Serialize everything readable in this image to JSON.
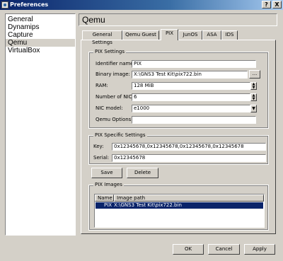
{
  "window": {
    "title": "Preferences",
    "help_label": "?",
    "close_label": "X"
  },
  "categories": [
    "General",
    "Dynamips",
    "Capture",
    "Qemu",
    "VirtualBox"
  ],
  "selected_category": "Qemu",
  "header": {
    "title": "Qemu"
  },
  "tabs": [
    "General Settings",
    "Qemu Guest",
    "PIX",
    "JunOS",
    "ASA",
    "IDS"
  ],
  "active_tab": "PIX",
  "pix_settings": {
    "group_title": "PIX Settings",
    "identifier_label": "Identifier name:",
    "identifier_value": "PIX",
    "binary_label": "Binary image:",
    "binary_value": "X:\\GNS3 Test Kit\\pix722.bin",
    "browse_label": "...",
    "ram_label": "RAM:",
    "ram_value": "128 MiB",
    "nics_label": "Number of NICs:",
    "nics_value": "6",
    "nic_model_label": "NIC model:",
    "nic_model_value": "e1000",
    "qemu_options_label": "Qemu Options:",
    "qemu_options_value": ""
  },
  "pix_specific": {
    "group_title": "PIX Specific Settings",
    "key_label": "Key:",
    "key_value": "0x12345678,0x12345678,0x12345678,0x12345678",
    "serial_label": "Serial:",
    "serial_value": "0x12345678"
  },
  "actions": {
    "save_label": "Save",
    "delete_label": "Delete"
  },
  "pix_images": {
    "group_title": "PIX Images",
    "columns": [
      "Name",
      "Image path"
    ],
    "rows": [
      {
        "name": "PIX",
        "path": "X:\\GNS3 Test Kit\\pix722.bin"
      }
    ]
  },
  "footer": {
    "ok_label": "OK",
    "cancel_label": "Cancel",
    "apply_label": "Apply"
  },
  "colors": {
    "titlebar_start": "#0a246a",
    "titlebar_end": "#a6caf0",
    "selection": "#0a246a",
    "dialog_bg": "#d4d0c8"
  }
}
